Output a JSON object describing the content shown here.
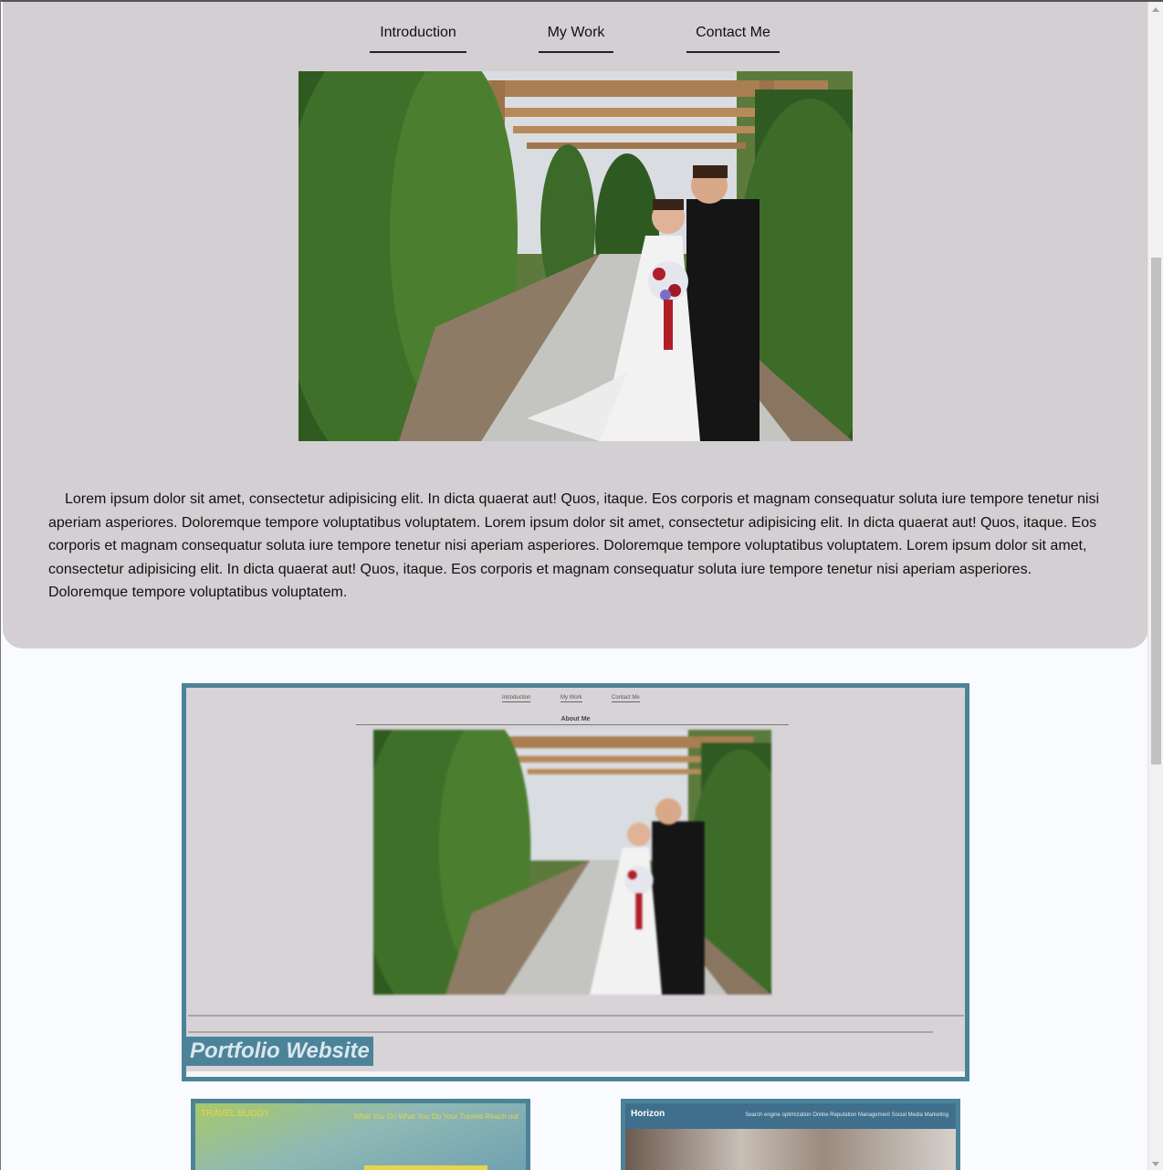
{
  "nav": {
    "items": [
      "Introduction",
      "My Work",
      "Contact Me"
    ]
  },
  "intro": {
    "paragraph": "Lorem ipsum dolor sit amet, consectetur adipisicing elit. In dicta quaerat aut! Quos, itaque. Eos corporis et magnam consequatur soluta iure tempore tenetur nisi aperiam asperiores. Doloremque tempore voluptatibus voluptatem. Lorem ipsum dolor sit amet, consectetur adipisicing elit. In dicta quaerat aut! Quos, itaque. Eos corporis et magnam consequatur soluta iure tempore tenetur nisi aperiam asperiores. Doloremque tempore voluptatibus voluptatem. Lorem ipsum dolor sit amet, consectetur adipisicing elit. In dicta quaerat aut! Quos, itaque. Eos corporis et magnam consequatur soluta iure tempore tenetur nisi aperiam asperiores. Doloremque tempore voluptatibus voluptatem."
  },
  "projects": {
    "portfolio": {
      "label": "Portfolio Website",
      "preview_nav": [
        "Introduction",
        "My Work",
        "Contact Me"
      ],
      "preview_title": "About Me"
    },
    "travel": {
      "brand": "TRAVEL BUDDY",
      "links": "What You Do  What You Do  Your Travels  Reach out"
    },
    "horizon": {
      "brand": "Horizon",
      "links": "Search engine optimization   Online Reputation Management   Social Media Marketing"
    }
  },
  "colors": {
    "hero_bg": "#d3cfd3",
    "page_bg": "#f9fbff",
    "card_border": "#4c8398"
  }
}
